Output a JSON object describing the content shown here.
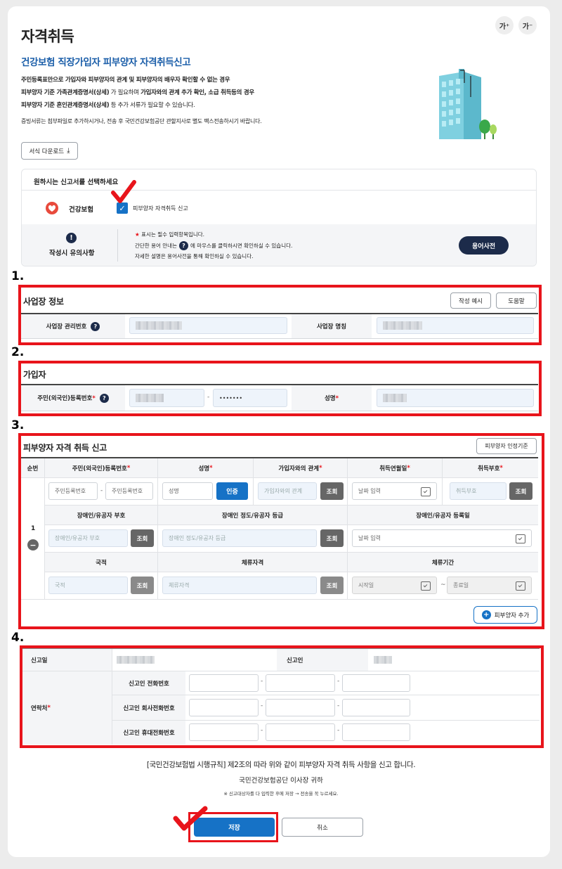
{
  "header": {
    "title": "자격취득",
    "subtitle": "건강보험 직장가입자 피부양자 자격취득신고",
    "font_increase": "가⁺",
    "font_decrease": "가⁻"
  },
  "description": {
    "line1": "주민등록표만으로 가입자와 피부양자의 관계 및 피부양자의 배우자 확인할 수 없는 경우",
    "line2_a": "피부양자 기준 가족관계증명서(상세)",
    "line2_b": " 가 필요하며 ",
    "line2_c": "가입자와의 관계 추가 확인, 소급 취득등의 경우",
    "line3_a": "피부양자 기준 혼인관계증명서(상세)",
    "line3_b": " 등 추가 서류가 필요할 수 있습니다.",
    "line4": "증빙서류는 첨부파일로 추가하시거나, 전송 후 국민건강보험공단 관할지사로 별도 팩스전송하시기 바랍니다.",
    "download_label": "서식 다운로드"
  },
  "selector": {
    "heading": "원하시는 신고서를 선택하세요",
    "service_name": "건강보험",
    "checkbox_label": "피부양자 자격취득 신고",
    "notice_title": "작성시 유의사항",
    "notice_line1_star": "★",
    "notice_line1": " 표시는 필수 입력항목입니다.",
    "notice_line2_a": "간단한 용어 안내는",
    "notice_line2_b": "에 마우스를 클릭하시면 확인하실 수 있습니다.",
    "notice_line3": "자세한 설명은 용어사전을 통해 확인하실 수 있습니다.",
    "dictionary_button": "용어사전"
  },
  "annotations": {
    "n1": "1.",
    "n2": "2.",
    "n3": "3.",
    "n4": "4."
  },
  "workplace": {
    "title": "사업장 정보",
    "example_button": "작성 예시",
    "help_button": "도움말",
    "mgmt_no_label": "사업장 관리번호",
    "name_label": "사업장 명칭"
  },
  "subscriber": {
    "title": "가입자",
    "rrn_label": "주민(외국인)등록번호",
    "rrn_back": "•••••••",
    "name_label": "성명"
  },
  "dependent": {
    "title": "피부양자 자격 취득 신고",
    "criteria_button": "피부양자 인정기준",
    "columns": [
      "순번",
      "주민(외국인)등록번호",
      "성명",
      "가입자와의 관계",
      "취득연월일",
      "취득부호"
    ],
    "row_no": "1",
    "rrn_front_ph": "주민등록번호",
    "rrn_back_ph": "주민등록번호",
    "name_ph": "성명",
    "verify_button": "인증",
    "relation_ph": "가입자와의 관계",
    "lookup": "조회",
    "date_ph": "날짜 입력",
    "code_ph": "취득부호",
    "sub_headers": [
      "장애인/유공자 부호",
      "장애인 정도/유공자 등급",
      "장애인/유공자 등록일"
    ],
    "disability_code_ph": "장애인/유공자 부호",
    "disability_grade_ph": "장애인 정도/유공자 등급",
    "sub_headers2": [
      "국적",
      "체류자격",
      "체류기간"
    ],
    "nationality_ph": "국적",
    "stay_status_ph": "체류자격",
    "start_ph": "시작일",
    "end_ph": "종료일",
    "tilde": "~",
    "add_button": "피부양자 추가"
  },
  "report": {
    "date_label": "신고일",
    "reporter_label": "신고인",
    "contact_label": "연락처",
    "phone_label": "신고인 전화번호",
    "office_phone_label": "신고인 회사전화번호",
    "mobile_label": "신고인 휴대전화번호",
    "dash": "-"
  },
  "footer": {
    "statement": "[국민건강보험법 시행규칙] 제2조의 따라 위와 같이 피부양자 자격 취득 사항을 신고 합니다.",
    "addressee": "국민건강보험공단 이사장 귀하",
    "note": "※ 신고대상자를 다 입력한 후에 저장 → 전송을 꼭 누르세요.",
    "save_button": "저장",
    "cancel_button": "취소"
  },
  "colors": {
    "accent": "#1b5ea9",
    "annotation_red": "#e8141b",
    "primary_button": "#1672c6",
    "dark_button": "#1c2b4a"
  }
}
